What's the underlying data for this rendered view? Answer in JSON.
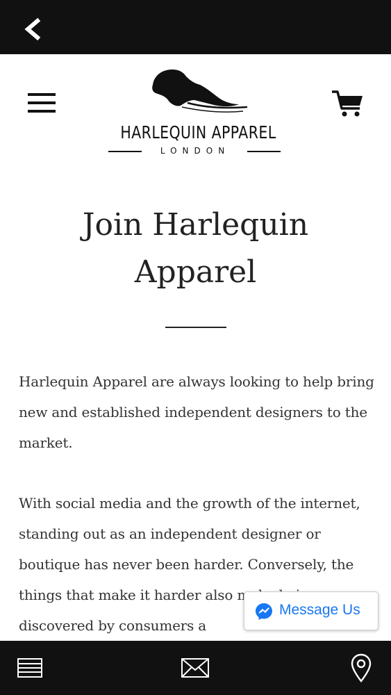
{
  "header": {
    "brand_name": "HARLEQUIN APPAREL",
    "brand_location": "LONDON"
  },
  "content": {
    "title_line1": "Join Harlequin",
    "title_line2": "Apparel",
    "paragraph1": "Harlequin Apparel are always looking to help bring new and established independent designers to the market.",
    "paragraph2": "With social media and the growth of the internet, standing out as an independent designer or boutique has never been harder. Conversely, the things that make it harder also make being discovered by consumers a"
  },
  "messenger": {
    "label": "Message Us",
    "color": "#1877f2"
  },
  "icons": {
    "back": "chevron-left-icon",
    "menu": "hamburger-menu-icon",
    "cart": "shopping-cart-icon",
    "list": "list-icon",
    "mail": "envelope-icon",
    "location": "map-pin-icon"
  },
  "colors": {
    "bar_background": "#111111",
    "text": "#222222"
  }
}
